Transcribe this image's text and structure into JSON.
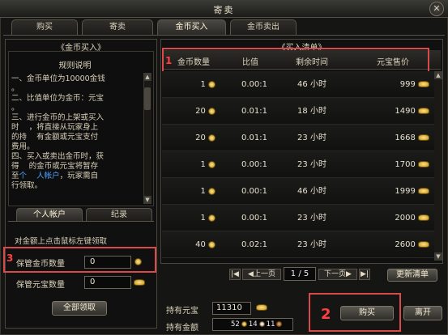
{
  "window": {
    "title": "寄卖",
    "close": "✕"
  },
  "tabs": [
    {
      "label": "购买",
      "active": false
    },
    {
      "label": "寄卖",
      "active": false
    },
    {
      "label": "金币买入",
      "active": true
    },
    {
      "label": "金币卖出",
      "active": false
    }
  ],
  "left": {
    "header": "《金币买入》",
    "rules_title": "规则说明",
    "rules_text_1": "一、金币单位为10000金钱\n。\n二、比值单位为金币：元宝\n。\n三、进行金币的上架或买入\n时    ，将直接从玩家身上\n的持    有金额或元宝支付\n费用。\n四、买入或卖出金币时，获\n得    的金币或元宝将暂存\n至",
    "rules_link": "个    人帐户",
    "rules_text_2": "，玩家需自\n行领取。",
    "subtabs": [
      {
        "label": "个人帐户",
        "active": true
      },
      {
        "label": "纪录",
        "active": false
      }
    ],
    "hint": "对金额上点击鼠标左键领取",
    "gold_label": "保管金币数量",
    "gold_value": "0",
    "yb_label": "保管元宝数量",
    "yb_value": "0",
    "claim_all": "全部领取",
    "marker3": "3"
  },
  "right": {
    "header": "《买入清单》",
    "marker1": "1",
    "columns": [
      "金币数量",
      "比值",
      "剩余时间",
      "元宝售价"
    ],
    "rows": [
      {
        "qty": "1",
        "ratio": "0.00:1",
        "time": "46 小时",
        "price": "999"
      },
      {
        "qty": "20",
        "ratio": "0.01:1",
        "time": "18 小时",
        "price": "1490"
      },
      {
        "qty": "20",
        "ratio": "0.01:1",
        "time": "23 小时",
        "price": "1668"
      },
      {
        "qty": "1",
        "ratio": "0.00:1",
        "time": "23 小时",
        "price": "1700"
      },
      {
        "qty": "1",
        "ratio": "0.00:1",
        "time": "46 小时",
        "price": "1999"
      },
      {
        "qty": "1",
        "ratio": "0.00:1",
        "time": "23 小时",
        "price": "2000"
      },
      {
        "qty": "40",
        "ratio": "0.02:1",
        "time": "23 小时",
        "price": "2600"
      }
    ],
    "pager": {
      "first": "|◀",
      "prev": "◀上一页",
      "page": "1",
      "sep": "/",
      "total": "5",
      "next": "下一页▶",
      "last": "▶|"
    },
    "refresh": "更新清单"
  },
  "bottom": {
    "yb_label": "持有元宝",
    "yb_value": "11310",
    "money_label": "持有金额",
    "money_gold": "52",
    "money_silver": "14",
    "money_copper": "11",
    "buy": "购买",
    "leave": "离开",
    "marker2": "2"
  }
}
